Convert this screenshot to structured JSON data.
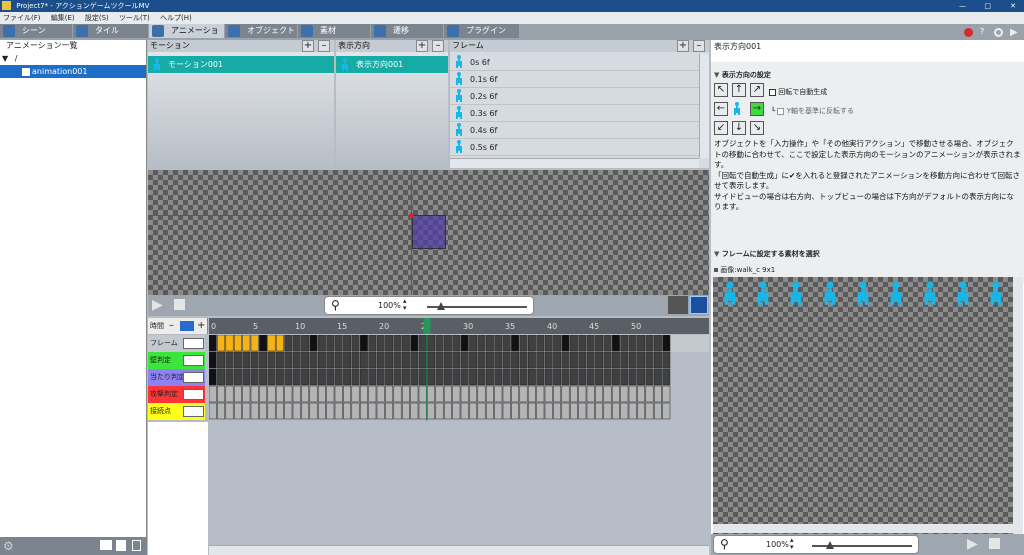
{
  "window": {
    "title": "Project7* - アクションゲームツクールMV"
  },
  "menu": [
    "ファイル(F)",
    "編集(E)",
    "設定(S)",
    "ツール(T)",
    "ヘルプ(H)"
  ],
  "tabs": [
    {
      "label": "シーン",
      "icon": "scene-icon"
    },
    {
      "label": "タイル",
      "icon": "tile-icon"
    },
    {
      "label": "アニメーション",
      "icon": "animation-icon"
    },
    {
      "label": "オブジェクト",
      "icon": "object-icon"
    },
    {
      "label": "素材",
      "icon": "material-icon"
    },
    {
      "label": "遷移",
      "icon": "transition-icon"
    },
    {
      "label": "プラグイン",
      "icon": "plugin-icon"
    }
  ],
  "sidebar": {
    "title": "アニメーション一覧",
    "root": "/",
    "item": "animation001"
  },
  "motion": {
    "title": "モーション",
    "item": "モーション001"
  },
  "direction": {
    "title": "表示方向",
    "item": "表示方向001"
  },
  "frames": {
    "title": "フレーム",
    "items": [
      "0s 6f",
      "0.1s 6f",
      "0.2s 6f",
      "0.3s 6f",
      "0.4s 6f",
      "0.5s 6f"
    ]
  },
  "preview": {
    "zoom": "100%"
  },
  "timeline": {
    "time_label": "時間",
    "ticks": [
      "0",
      "5",
      "10",
      "15",
      "20",
      "25",
      "30",
      "35",
      "40",
      "45",
      "50"
    ],
    "rows": [
      {
        "label": "フレーム",
        "color": "#c4c9d0"
      },
      {
        "label": "壁判定",
        "color": "#39e639"
      },
      {
        "label": "当たり判定",
        "color": "#8d82f2"
      },
      {
        "label": "攻撃判定",
        "color": "#ff3535"
      },
      {
        "label": "接続点",
        "color": "#ffff1a"
      }
    ]
  },
  "right": {
    "header": "表示方向001",
    "section1": "表示方向の設定",
    "auto_rotate": "回転で自動生成",
    "flip_y": "Y軸を基準に反転する",
    "description": [
      "オブジェクトを「入力操作」や「その他実行アクション」で移動させる場合、オブジェクトの移動に合わせて、ここで設定した表示方向のモーションのアニメーションが表示されます。",
      "「回転で自動生成」に✔を入れると登録されたアニメーションを移動方向に合わせて回転させて表示します。",
      "サイドビューの場合は右方向、トップビューの場合は下方向がデフォルトの表示方向になります。"
    ],
    "section2": "フレームに設定する素材を選択",
    "image_label": "画像:walk_c 9x1",
    "zoom": "100%"
  },
  "colors": {
    "accent": "#18b8e8",
    "selected_teal": "#16aba5",
    "frame_orange": "#f5b316",
    "titlebar": "#1b4e8a"
  }
}
